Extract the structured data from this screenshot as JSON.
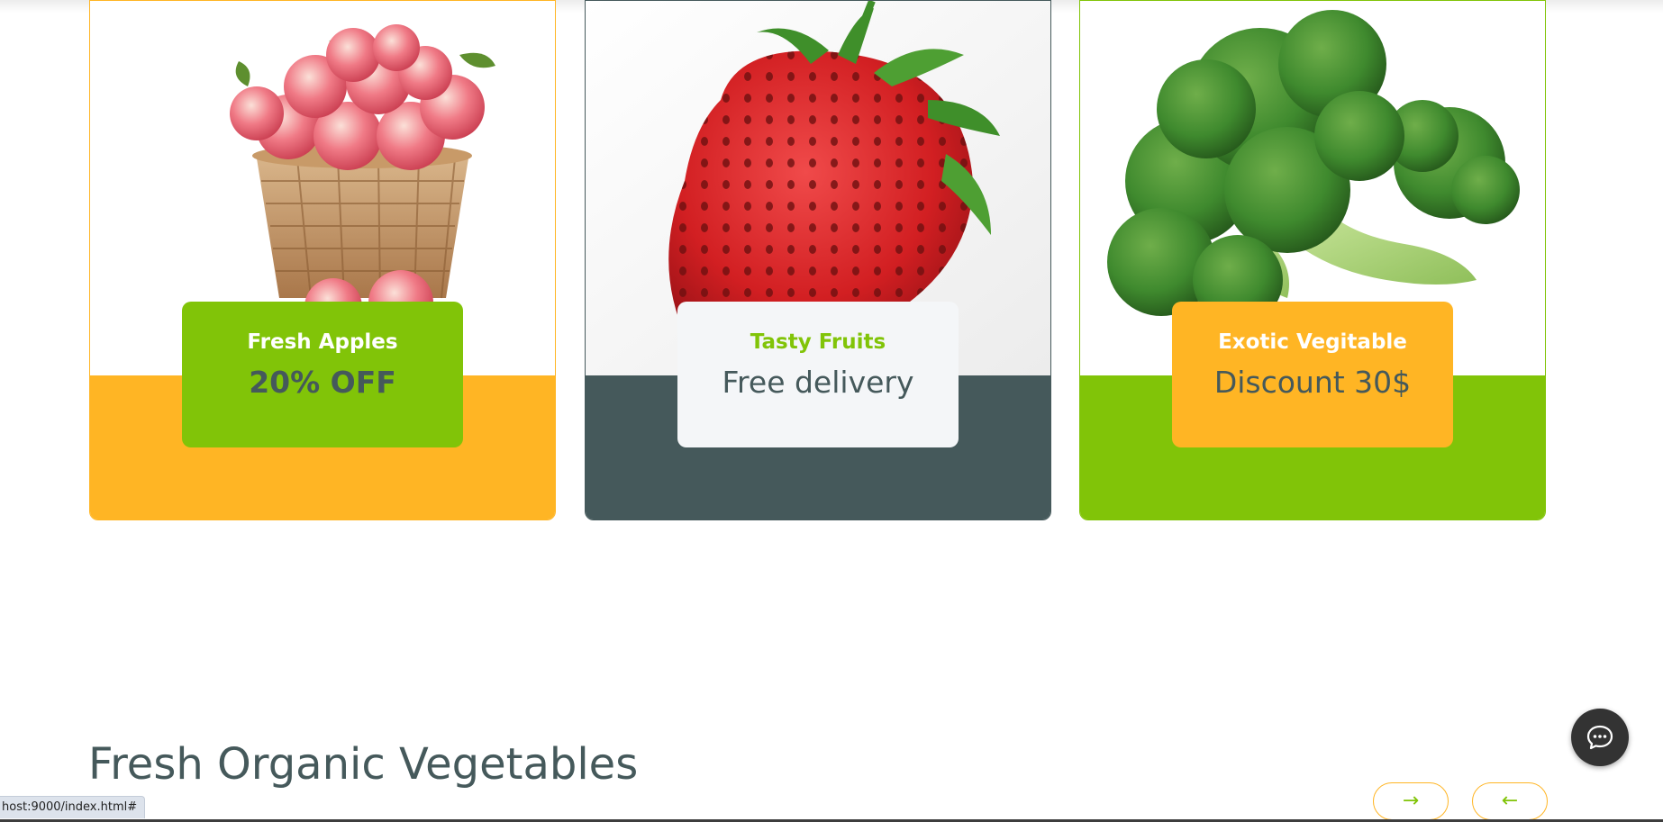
{
  "promos": [
    {
      "subtitle": "Fresh Apples",
      "headline": "20% OFF",
      "accent_color": "#81c408",
      "base_color": "#ffb524",
      "image_icon": "apple-basket-icon"
    },
    {
      "subtitle": "Tasty Fruits",
      "headline": "Free delivery",
      "accent_color": "#f4f6f8",
      "base_color": "#45595b",
      "image_icon": "strawberry-icon"
    },
    {
      "subtitle": "Exotic Vegitable",
      "headline": "Discount 30$",
      "accent_color": "#ffb524",
      "base_color": "#81c408",
      "image_icon": "broccoli-icon"
    }
  ],
  "section": {
    "title": "Fresh Organic Vegetables"
  },
  "carousel": {
    "next_glyph": "→",
    "prev_glyph": "←",
    "next_icon": "arrow-right-icon",
    "prev_icon": "arrow-left-icon"
  },
  "chat": {
    "icon": "chat-bubble-icon"
  },
  "status_bar": {
    "url": "host:9000/index.html#"
  },
  "colors": {
    "primary_green": "#81c408",
    "secondary_orange": "#ffb524",
    "dark_slate": "#45595b",
    "light_gray": "#f4f6f8"
  }
}
